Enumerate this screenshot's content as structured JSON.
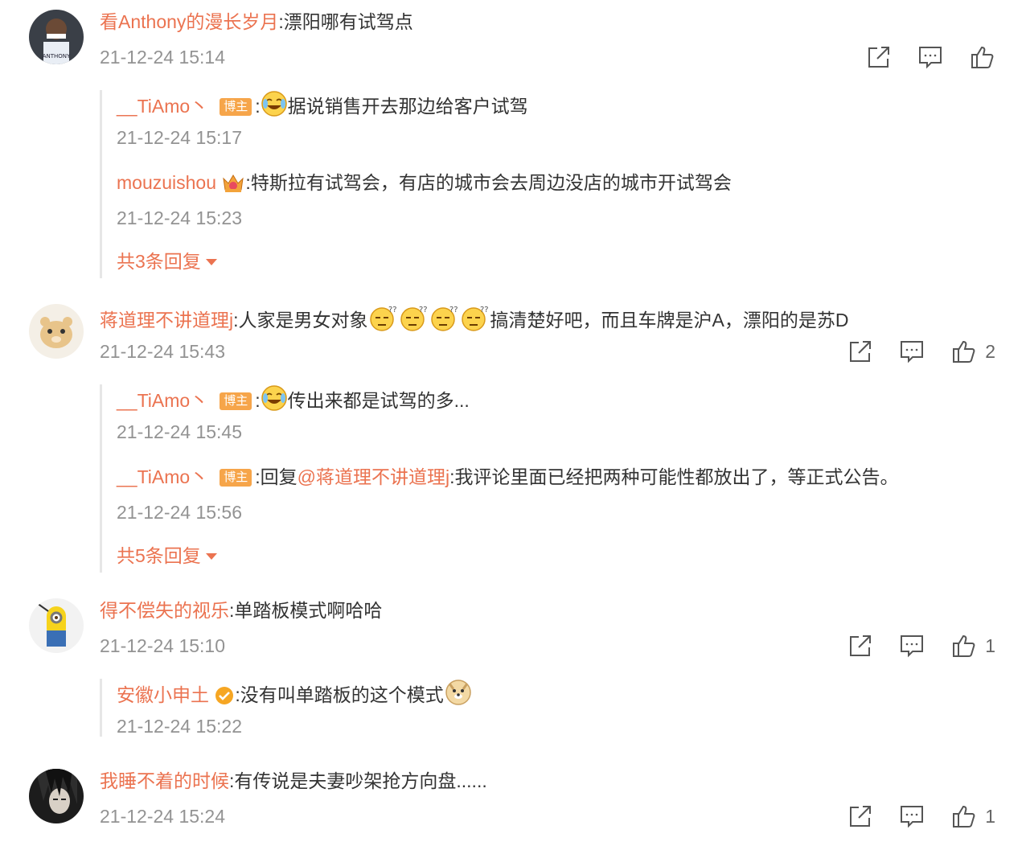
{
  "comments": [
    {
      "user": "看Anthony的漫长岁月",
      "text": "漂阳哪有试驾点",
      "time": "21-12-24 15:14",
      "likes": "",
      "replies": [
        {
          "user": "__TiAmo丶",
          "badge": "博主",
          "text": "据说销售开去那边给客户试驾",
          "time": "21-12-24 15:17"
        },
        {
          "user": "mouzuishou",
          "text": "特斯拉有试驾会，有店的城市会去周边没店的城市开试驾会",
          "time": "21-12-24 15:23"
        }
      ],
      "more": "共3条回复"
    },
    {
      "user": "蒋道理不讲道理j",
      "text_a": "人家是男女对象",
      "text_b": "搞清楚好吧，而且车牌是沪A，漂阳的是苏D",
      "time": "21-12-24 15:43",
      "likes": "2",
      "replies": [
        {
          "user": "__TiAmo丶",
          "badge": "博主",
          "text": "传出来都是试驾的多...",
          "time": "21-12-24 15:45"
        },
        {
          "user": "__TiAmo丶",
          "badge": "博主",
          "reply_prefix": "回复",
          "mention": "@蒋道理不讲道理j",
          "text": "我评论里面已经把两种可能性都放出了，等正式公告。",
          "time": "21-12-24 15:56"
        }
      ],
      "more": "共5条回复"
    },
    {
      "user": "得不偿失的视乐",
      "text": "单踏板模式啊哈哈",
      "time": "21-12-24 15:10",
      "likes": "1",
      "replies": [
        {
          "user": "安徽小申土",
          "text": "没有叫单踏板的这个模式",
          "time": "21-12-24 15:22"
        }
      ]
    },
    {
      "user": "我睡不着的时候",
      "text": "有传说是夫妻吵架抢方向盘......",
      "time": "21-12-24 15:24",
      "likes": "1"
    }
  ],
  "icons": {
    "share": "share-icon",
    "comment": "comment-icon",
    "like": "thumbs-up-icon"
  },
  "colors": {
    "name": "#eb7350",
    "time": "#939393",
    "badge": "#f6a54a"
  }
}
